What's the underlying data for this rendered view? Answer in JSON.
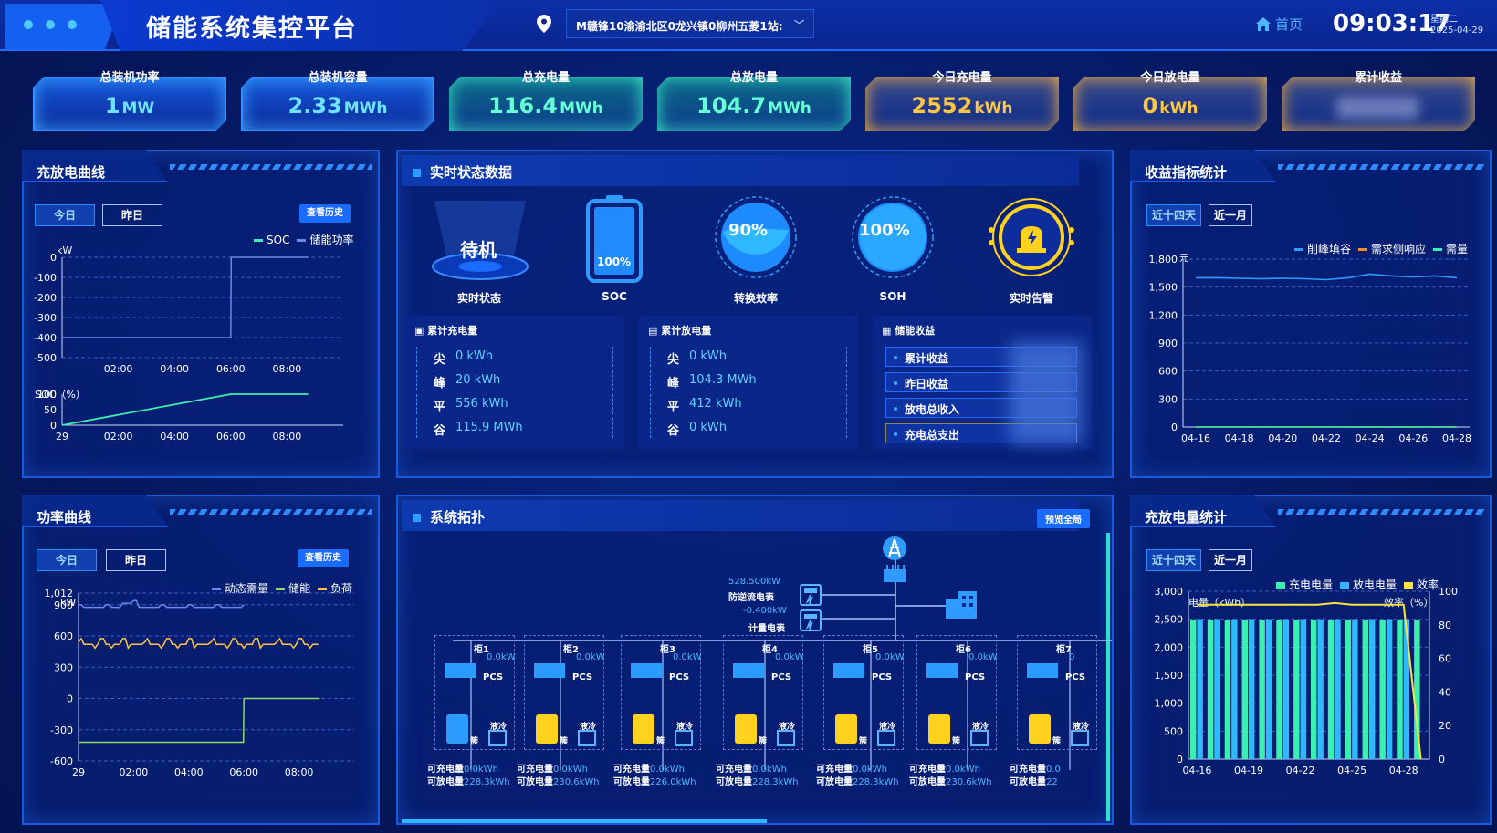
{
  "header": {
    "title": "储能系统集控平台",
    "site": "M赣锋10渝渝北区0龙兴镇0柳州五菱1站:",
    "home": "首页",
    "time": "09:03:17",
    "weekday": "星期二",
    "date": "2025-04-29"
  },
  "kpis": [
    {
      "label": "总装机功率",
      "value": "1",
      "unit": "MW"
    },
    {
      "label": "总装机容量",
      "value": "2.33",
      "unit": "MWh"
    },
    {
      "label": "总充电量",
      "value": "116.4",
      "unit": "MWh"
    },
    {
      "label": "总放电量",
      "value": "104.7",
      "unit": "MWh"
    },
    {
      "label": "今日充电量",
      "value": "2552",
      "unit": "kWh"
    },
    {
      "label": "今日放电量",
      "value": "0",
      "unit": "kWh"
    },
    {
      "label": "累计收益",
      "value": "",
      "unit": ""
    }
  ],
  "charge_curve": {
    "title": "充放电曲线",
    "tab_today": "今日",
    "tab_yesterday": "昨日",
    "history": "查看历史",
    "legend": [
      "SOC",
      "储能功率"
    ],
    "unit_top": "kW",
    "unit_bottom": "SOC（%）",
    "y_top": [
      "0",
      "-100",
      "-200",
      "-300",
      "-400",
      "-500"
    ],
    "y_bottom": [
      "100",
      "50",
      "0"
    ],
    "x_top": [
      "02:00",
      "04:00",
      "06:00",
      "08:00"
    ],
    "x_bottom": [
      "29",
      "02:00",
      "04:00",
      "06:00",
      "08:00"
    ]
  },
  "power_curve": {
    "title": "功率曲线",
    "tab_today": "今日",
    "tab_yesterday": "昨日",
    "history": "查看历史",
    "legend": [
      "动态需量",
      "储能",
      "负荷"
    ],
    "unit": "kW",
    "y": [
      "1,012",
      "900",
      "600",
      "300",
      "0",
      "-300",
      "-600"
    ],
    "x": [
      "29",
      "02:00",
      "04:00",
      "06:00",
      "08:00"
    ]
  },
  "realtime": {
    "title": "实时状态数据",
    "state": "待机",
    "state_label": "实时状态",
    "soc_value": "100%",
    "soc_label": "SOC",
    "eff_value": "90%",
    "eff_label": "转换效率",
    "soh_value": "100%",
    "soh_label": "SOH",
    "alarm_label": "实时告警",
    "charge_title": "累计充电量",
    "charge_rows": [
      {
        "k": "尖",
        "v": "0 kWh"
      },
      {
        "k": "峰",
        "v": "20 kWh"
      },
      {
        "k": "平",
        "v": "556 kWh"
      },
      {
        "k": "谷",
        "v": "115.9 MWh"
      }
    ],
    "discharge_title": "累计放电量",
    "discharge_rows": [
      {
        "k": "尖",
        "v": "0 kWh"
      },
      {
        "k": "峰",
        "v": "104.3 MWh"
      },
      {
        "k": "平",
        "v": "412 kWh"
      },
      {
        "k": "谷",
        "v": "0 kWh"
      }
    ],
    "income_title": "储能收益",
    "income_rows": [
      "累计收益",
      "昨日收益",
      "放电总收入",
      "充电总支出"
    ]
  },
  "income_stats": {
    "title": "收益指标统计",
    "tab_14": "近十四天",
    "tab_month": "近一月",
    "legend": [
      "削峰填谷",
      "需求侧响应",
      "需量"
    ],
    "unit": "元",
    "y": [
      "1,800",
      "1,500",
      "1,200",
      "900",
      "600",
      "300",
      "0"
    ],
    "x": [
      "04-16",
      "04-18",
      "04-20",
      "04-22",
      "04-24",
      "04-26",
      "04-28"
    ]
  },
  "topology": {
    "title": "系统拓扑",
    "preview": "预览全局",
    "meter1_value": "528.500kW",
    "meter1_label": "防逆流电表",
    "meter2_value": "-0.400kW",
    "meter2_label": "计量电表",
    "pcs": "PCS",
    "liquid": "液冷",
    "cluster": "簇",
    "can_charge": "可充电量",
    "can_discharge": "可放电量",
    "cabinets": [
      {
        "name": "柜1",
        "power": "0.0kW",
        "charge": "0.0kWh",
        "discharge": "228.3kWh",
        "color": "#2c9bff"
      },
      {
        "name": "柜2",
        "power": "0.0kW",
        "charge": "0.0kWh",
        "discharge": "230.6kWh",
        "color": "#ffd21f"
      },
      {
        "name": "柜3",
        "power": "0.0kW",
        "charge": "0.0kWh",
        "discharge": "226.0kWh",
        "color": "#ffd21f"
      },
      {
        "name": "柜4",
        "power": "0.0kW",
        "charge": "0.0kWh",
        "discharge": "228.3kWh",
        "color": "#ffd21f"
      },
      {
        "name": "柜5",
        "power": "0.0kW",
        "charge": "0.0kWh",
        "discharge": "228.3kWh",
        "color": "#ffd21f"
      },
      {
        "name": "柜6",
        "power": "0.0kW",
        "charge": "0.0kWh",
        "discharge": "230.6kWh",
        "color": "#ffd21f"
      },
      {
        "name": "柜7",
        "power": "0",
        "charge": "0.0",
        "discharge": "22",
        "color": "#ffd21f"
      }
    ]
  },
  "charge_stats": {
    "title": "充放电量统计",
    "tab_14": "近十四天",
    "tab_month": "近一月",
    "legend": [
      "充电电量",
      "放电电量",
      "效率"
    ],
    "unit_left": "电量（kWh）",
    "unit_right": "效率（%）",
    "y_left": [
      "3,000",
      "2,500",
      "2,000",
      "1,500",
      "1,000",
      "500",
      "0"
    ],
    "y_right": [
      "100",
      "80",
      "60",
      "40",
      "20",
      "0"
    ],
    "x": [
      "04-16",
      "04-19",
      "04-22",
      "04-25",
      "04-28"
    ]
  },
  "chart_data": [
    {
      "type": "line",
      "title": "充放电曲线",
      "series": [
        {
          "name": "储能功率",
          "x": [
            "00:00",
            "01:48",
            "06:00",
            "06:01",
            "08:45"
          ],
          "values": [
            -400,
            -400,
            -400,
            0,
            0
          ]
        },
        {
          "name": "SOC",
          "x": [
            "00:00",
            "06:00",
            "08:45"
          ],
          "values": [
            0,
            100,
            100
          ]
        }
      ],
      "ylim_top": [
        -500,
        0
      ],
      "ylim_bottom": [
        0,
        100
      ]
    },
    {
      "type": "line",
      "title": "功率曲线",
      "series": [
        {
          "name": "动态需量",
          "x": [
            "00:00",
            "06:00"
          ],
          "values": [
            900,
            900
          ]
        },
        {
          "name": "负荷",
          "x": [
            "00:00",
            "06:00",
            "08:45"
          ],
          "values": [
            520,
            500,
            540
          ]
        },
        {
          "name": "储能",
          "x": [
            "00:00",
            "05:59",
            "06:00",
            "08:45"
          ],
          "values": [
            -420,
            -420,
            0,
            0
          ]
        }
      ],
      "ylim": [
        -600,
        1012
      ]
    },
    {
      "type": "line",
      "title": "收益指标统计",
      "categories": [
        "04-16",
        "04-17",
        "04-18",
        "04-19",
        "04-20",
        "04-21",
        "04-22",
        "04-23",
        "04-24",
        "04-25",
        "04-26",
        "04-27",
        "04-28"
      ],
      "series": [
        {
          "name": "削峰填谷",
          "values": [
            1600,
            1600,
            1595,
            1590,
            1595,
            1590,
            1580,
            1600,
            1640,
            1620,
            1610,
            1620,
            1600
          ]
        },
        {
          "name": "需求侧响应",
          "values": [
            0,
            0,
            0,
            0,
            0,
            0,
            0,
            0,
            0,
            0,
            0,
            0,
            0
          ]
        },
        {
          "name": "需量",
          "values": [
            0,
            0,
            0,
            0,
            0,
            0,
            0,
            0,
            0,
            0,
            0,
            0,
            0
          ]
        }
      ],
      "ylim": [
        0,
        1800
      ]
    },
    {
      "type": "bar",
      "title": "充放电量统计",
      "categories": [
        "04-16",
        "04-17",
        "04-18",
        "04-19",
        "04-20",
        "04-21",
        "04-22",
        "04-23",
        "04-24",
        "04-25",
        "04-26",
        "04-27",
        "04-28",
        "04-29"
      ],
      "series": [
        {
          "name": "充电电量",
          "values": [
            2480,
            2480,
            2480,
            2480,
            2480,
            2480,
            2480,
            2480,
            2480,
            2480,
            2480,
            2480,
            2480,
            2480
          ]
        },
        {
          "name": "放电电量",
          "values": [
            2500,
            2500,
            2500,
            2500,
            2500,
            2500,
            2500,
            2500,
            2500,
            2500,
            2500,
            2500,
            2500,
            0
          ]
        },
        {
          "name": "效率",
          "values": [
            92,
            92,
            92,
            92,
            92,
            92,
            92,
            92,
            93,
            92,
            92,
            92,
            92,
            0
          ]
        }
      ],
      "ylim": [
        0,
        3000
      ],
      "ylim_right": [
        0,
        100
      ]
    }
  ]
}
